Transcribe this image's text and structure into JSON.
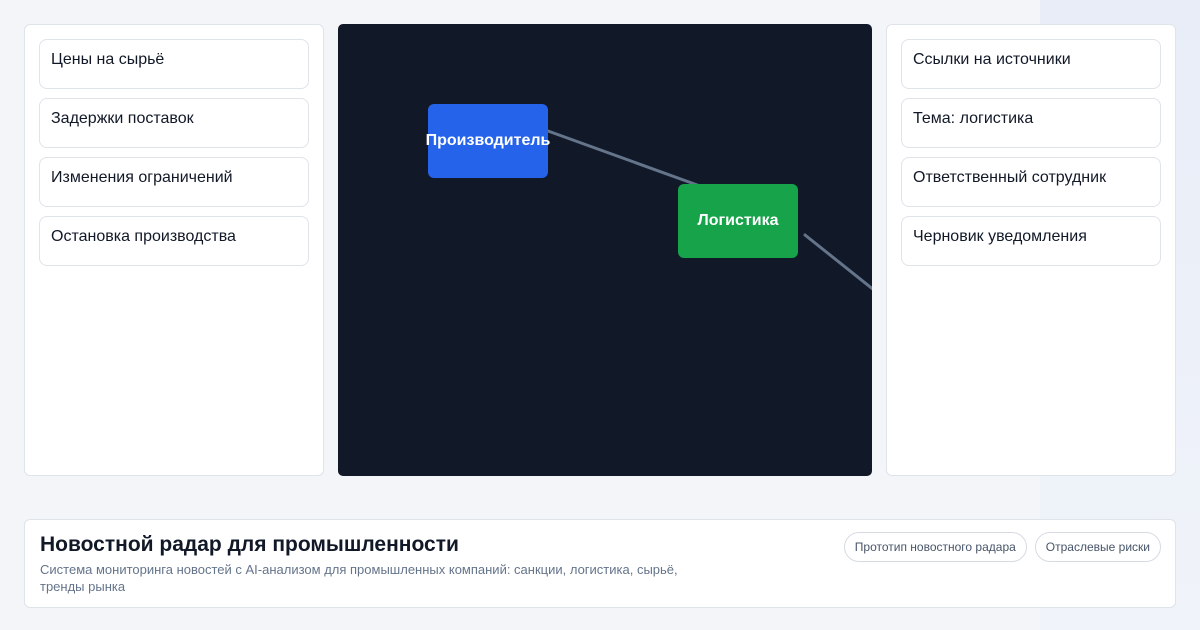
{
  "left_panel": {
    "items": [
      {
        "label": "Цены на сырьё"
      },
      {
        "label": "Задержки поставок"
      },
      {
        "label": "Изменения ограничений"
      },
      {
        "label": "Остановка производства"
      }
    ]
  },
  "diagram": {
    "nodes": [
      {
        "label": "Производитель",
        "color": "#2563eb"
      },
      {
        "label": "Логистика",
        "color": "#16a34a"
      }
    ],
    "background_color": "#111827",
    "edge_color": "#64748b"
  },
  "right_panel": {
    "items": [
      {
        "label": "Ссылки на источники"
      },
      {
        "label": "Тема: логистика"
      },
      {
        "label": "Ответственный сотрудник"
      },
      {
        "label": "Черновик уведомления"
      }
    ]
  },
  "footer": {
    "title": "Новостной радар для промышленности",
    "description": "Система мониторинга новостей с AI-анализом для промышленных компаний: санкции, логистика, сырьё, тренды рынка",
    "badges": [
      {
        "label": "Прототип новостного радара"
      },
      {
        "label": "Отраслевые риски"
      }
    ]
  }
}
